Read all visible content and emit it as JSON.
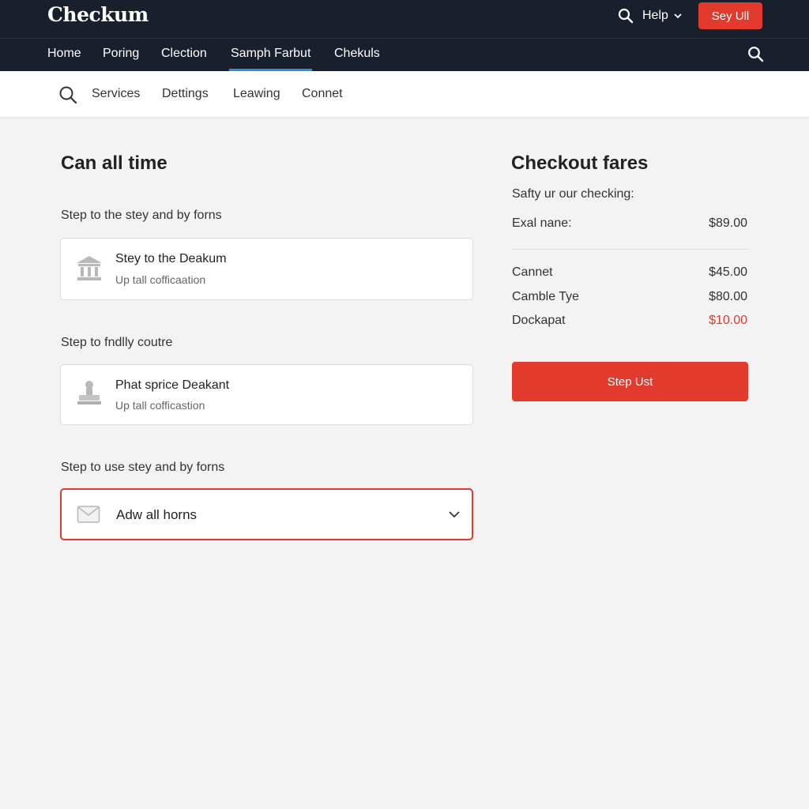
{
  "header": {
    "logo": "Checkum",
    "help_label": "Help",
    "signup_label": "Sey Ull"
  },
  "nav": {
    "items": [
      {
        "label": "Home"
      },
      {
        "label": "Poring"
      },
      {
        "label": "Clection"
      },
      {
        "label": "Samph Farbut",
        "active": true
      },
      {
        "label": "Chekuls"
      }
    ]
  },
  "subnav": {
    "items": [
      {
        "label": "Services"
      },
      {
        "label": "Dettings"
      },
      {
        "label": "Leawing"
      },
      {
        "label": "Connet"
      }
    ]
  },
  "main": {
    "title": "Can all time",
    "sections": [
      {
        "label": "Step to the stey and by forns",
        "card": {
          "title": "Stey to the Deakum",
          "subtitle": "Up tall cofficaation",
          "icon": "bank-icon"
        }
      },
      {
        "label": "Step to fndlly coutre",
        "card": {
          "title": "Phat sprice Deakant",
          "subtitle": "Up tall cofficastion",
          "icon": "stamp-icon"
        }
      },
      {
        "label": "Step to use stey and by forns",
        "select": {
          "value": "Adw all horns",
          "icon": "envelope-icon"
        }
      }
    ]
  },
  "summary": {
    "title": "Checkout fares",
    "subtitle": "Safty ur our checking:",
    "first_row": {
      "label": "Exal nane:",
      "amount": "$89.00"
    },
    "rows": [
      {
        "label": "Cannet",
        "amount": "$45.00"
      },
      {
        "label": "Camble Tye",
        "amount": "$80.00"
      },
      {
        "label": "Dockapat",
        "amount": "$10.00"
      }
    ],
    "button_label": "Step Ust"
  },
  "colors": {
    "header_bg": "#18202e",
    "accent_red": "#e23b2e",
    "active_tab_underline": "#2f8fe0",
    "page_bg": "#f3f3f3"
  }
}
